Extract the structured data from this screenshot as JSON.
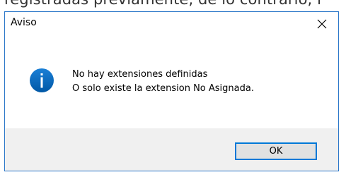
{
  "background": {
    "partial_text": "registradas previamente, de lo contrario, l"
  },
  "dialog": {
    "title": "Aviso",
    "close_icon": "close-icon",
    "message_icon": "info-icon",
    "message_lines": [
      "No hay extensiones definidas",
      "O solo existe la extension No Asignada."
    ],
    "ok_label": "OK"
  },
  "colors": {
    "border": "#2b77c9",
    "info_icon": "#0063b1",
    "button_focus": "#0078d7"
  }
}
